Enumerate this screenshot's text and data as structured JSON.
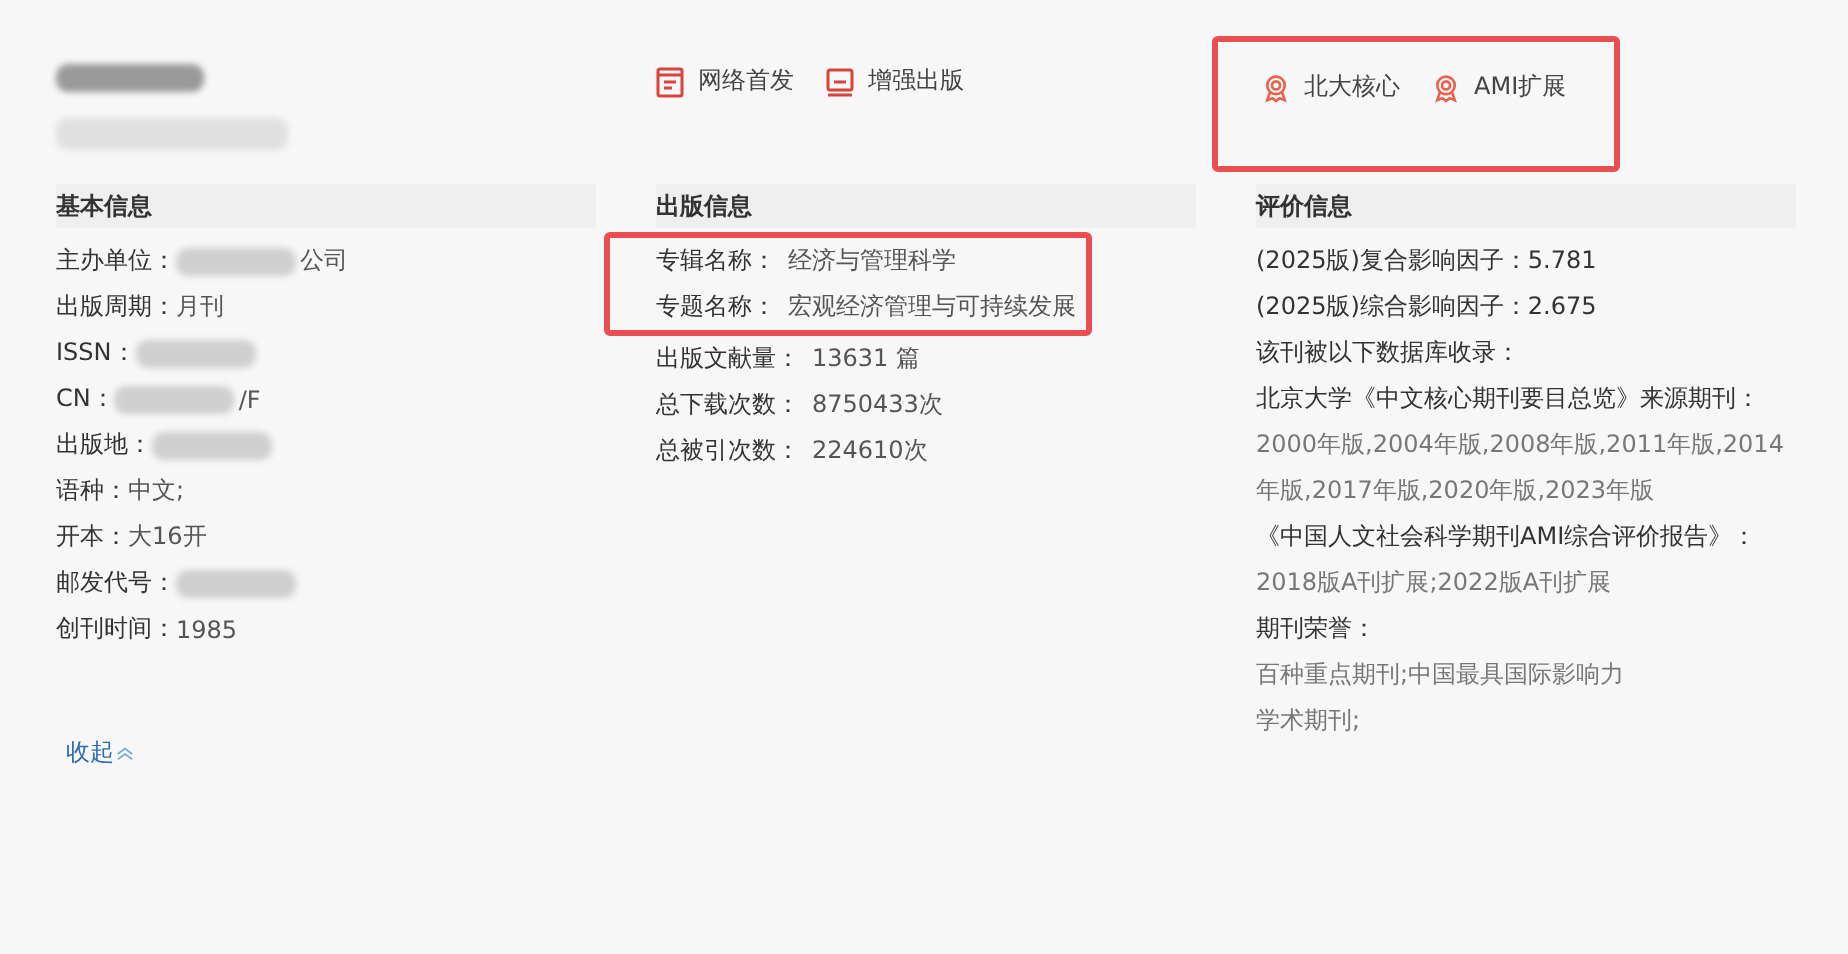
{
  "header": {
    "title_redacted": true,
    "subtitle_redacted": true,
    "features": [
      {
        "label": "网络首发"
      },
      {
        "label": "增强出版"
      }
    ],
    "badges": {
      "highlighted": true,
      "items": [
        {
          "label": "北大核心"
        },
        {
          "label": "AMI扩展"
        }
      ]
    }
  },
  "basic": {
    "title": "基本信息",
    "rows": [
      {
        "label": "主办单位：",
        "redacted": true,
        "value": "公司"
      },
      {
        "label": "出版周期：",
        "redacted": false,
        "value": "月刊"
      },
      {
        "label": "ISSN：",
        "redacted": true
      },
      {
        "label": "CN：",
        "redacted": true,
        "value": "/F"
      },
      {
        "label": "出版地：",
        "redacted": true
      },
      {
        "label": "语种：",
        "redacted": false,
        "value": "中文;"
      },
      {
        "label": "开本：",
        "redacted": false,
        "value": "大16开"
      },
      {
        "label": "邮发代号：",
        "redacted": true
      },
      {
        "label": "创刊时间：",
        "redacted": false,
        "value": "1985"
      }
    ]
  },
  "publish": {
    "title": "出版信息",
    "groups": [
      {
        "highlighted": true,
        "rows": [
          {
            "label": "专辑名称：",
            "value": "经济与管理科学"
          },
          {
            "label": "专题名称：",
            "value": "宏观经济管理与可持续发展"
          }
        ]
      },
      {
        "highlighted": false,
        "rows": [
          {
            "label": "出版文献量：",
            "value": "13631 篇"
          },
          {
            "label": "总下载次数：",
            "value": "8750433次"
          },
          {
            "label": "总被引次数：",
            "value": "224610次"
          }
        ]
      }
    ]
  },
  "evaluation": {
    "title": "评价信息",
    "lines": [
      {
        "kind": "label",
        "text": "(2025版)复合影响因子：5.781"
      },
      {
        "kind": "label",
        "text": "(2025版)综合影响因子：2.675"
      },
      {
        "kind": "label",
        "text": "该刊被以下数据库收录："
      },
      {
        "kind": "label",
        "text": "北京大学《中文核心期刊要目总览》来源期刊："
      },
      {
        "kind": "value",
        "text": "2000年版,2004年版,2008年版,2011年版,2014年版,2017年版,2020年版,2023年版"
      },
      {
        "kind": "label",
        "text": "《中国人文社会科学期刊AMI综合评价报告》："
      },
      {
        "kind": "value",
        "text": "2018版A刊扩展;2022版A刊扩展"
      },
      {
        "kind": "label",
        "text": "期刊荣誉："
      },
      {
        "kind": "value",
        "text": "百种重点期刊;中国最具国际影响力"
      },
      {
        "kind": "value",
        "text": "学术期刊;"
      }
    ]
  },
  "collapse_link": "收起"
}
